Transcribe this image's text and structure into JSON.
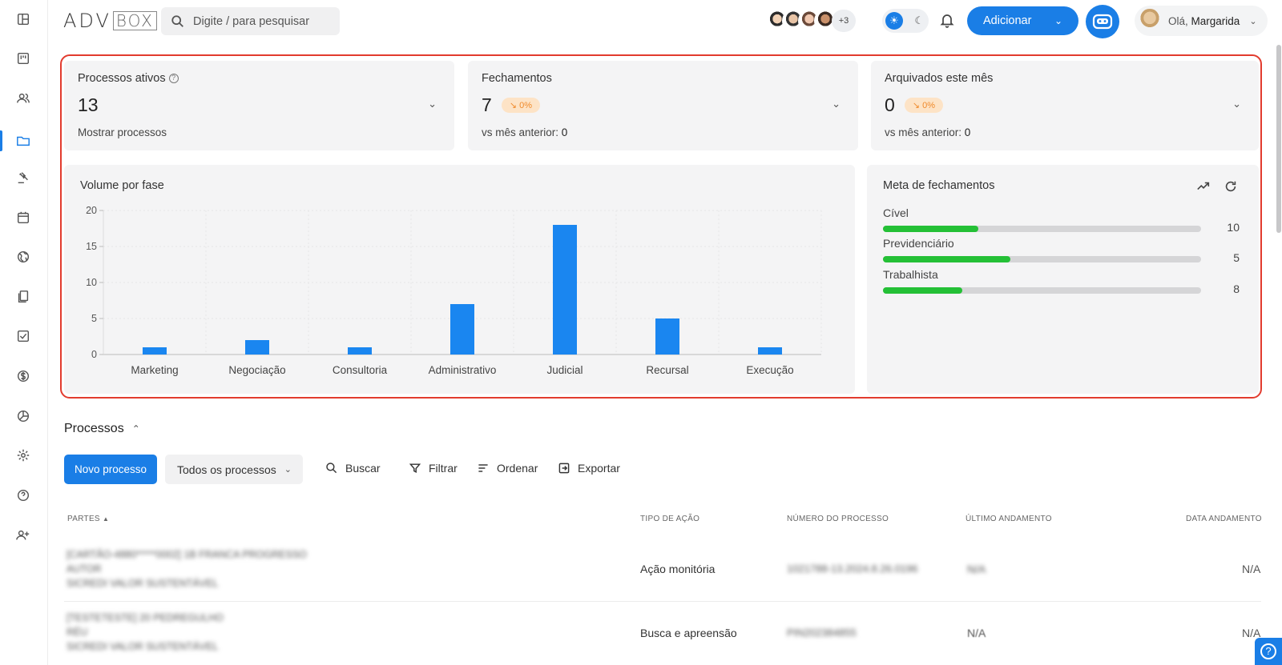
{
  "logo": {
    "left": "ADV",
    "right": "BOX"
  },
  "search": {
    "placeholder": "Digite / para pesquisar"
  },
  "header": {
    "more_users": "+3",
    "add_label": "Adicionar",
    "greeting": "Olá,",
    "user_name": "Margarida"
  },
  "stats": [
    {
      "title": "Processos ativos",
      "value": "13",
      "sub_text": "Mostrar processos"
    },
    {
      "title": "Fechamentos",
      "value": "7",
      "badge": "0%",
      "sub_text": "vs mês anterior:",
      "sub_value": "0"
    },
    {
      "title": "Arquivados este mês",
      "value": "0",
      "badge": "0%",
      "sub_text": "vs mês anterior:",
      "sub_value": "0"
    }
  ],
  "chart_data": {
    "type": "bar",
    "title": "Volume por fase",
    "categories": [
      "Marketing",
      "Negociação",
      "Consultoria",
      "Administrativo",
      "Judicial",
      "Recursal",
      "Execução"
    ],
    "values": [
      1,
      2,
      1,
      7,
      18,
      5,
      1
    ],
    "ylim": [
      0,
      20
    ],
    "yticks": [
      0,
      5,
      10,
      15,
      20
    ],
    "color": "#1a86f0",
    "grid": true
  },
  "goals": {
    "title": "Meta de fechamentos",
    "items": [
      {
        "label": "Cível",
        "value": "10",
        "progress": 0.3
      },
      {
        "label": "Previdenciário",
        "value": "5",
        "progress": 0.4
      },
      {
        "label": "Trabalhista",
        "value": "8",
        "progress": 0.25
      }
    ]
  },
  "processos": {
    "title": "Processos",
    "new_label": "Novo processo",
    "filter_select": "Todos os processos",
    "tools": {
      "buscar": "Buscar",
      "filtrar": "Filtrar",
      "ordenar": "Ordenar",
      "exportar": "Exportar"
    },
    "columns": {
      "partes": "PARTES",
      "tipo": "TIPO DE AÇÃO",
      "numero": "NÚMERO DO PROCESSO",
      "ultimo": "ÚLTIMO ANDAMENTO",
      "data": "DATA ANDAMENTO"
    },
    "rows": [
      {
        "partes": [
          "[CARTÃO-4880*****0002] 1B FRANCA PROGRESSO",
          "AUTOR",
          "SICREDI VALOR SUSTENTÁVEL"
        ],
        "tipo": "Ação monitória",
        "numero": "1021788-13.2024.8.26.0196",
        "ultimo": "N/A",
        "data": "N/A"
      },
      {
        "partes": [
          "[TESTETESTE] 20 PEDREGULHO",
          "RÉU",
          "SICREDI VALOR SUSTENTÁVEL"
        ],
        "tipo": "Busca e apreensão",
        "numero": "PIN202384855",
        "ultimo": "N/A",
        "data": "N/A"
      }
    ]
  },
  "colors": {
    "accent": "#1a7ee6",
    "progress": "#24c036",
    "highlight": "#e23b2e"
  }
}
